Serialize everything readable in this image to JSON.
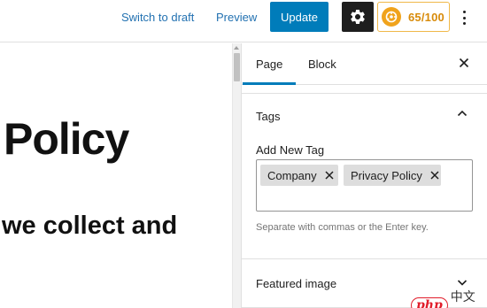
{
  "toolbar": {
    "switch_to_draft": "Switch to draft",
    "preview": "Preview",
    "update": "Update",
    "settings_icon": "gear-icon",
    "seo_score": "65/100",
    "more_icon": "vertical-ellipsis-icon"
  },
  "editor": {
    "heading": "Policy",
    "paragraph": "we collect and"
  },
  "sidebar": {
    "tabs": [
      {
        "label": "Page",
        "active": true
      },
      {
        "label": "Block",
        "active": false
      }
    ],
    "close_icon": "close-icon",
    "tags_panel": {
      "title": "Tags",
      "expanded": true,
      "add_label": "Add New Tag",
      "tags": [
        "Company",
        "Privacy Policy"
      ],
      "help": "Separate with commas or the Enter key."
    },
    "featured_panel": {
      "title": "Featured image",
      "expanded": false
    }
  },
  "watermark": {
    "logo": "php",
    "text": "中文网"
  },
  "colors": {
    "accent": "#007cba",
    "link": "#2271b1",
    "score": "#d88b0a"
  }
}
